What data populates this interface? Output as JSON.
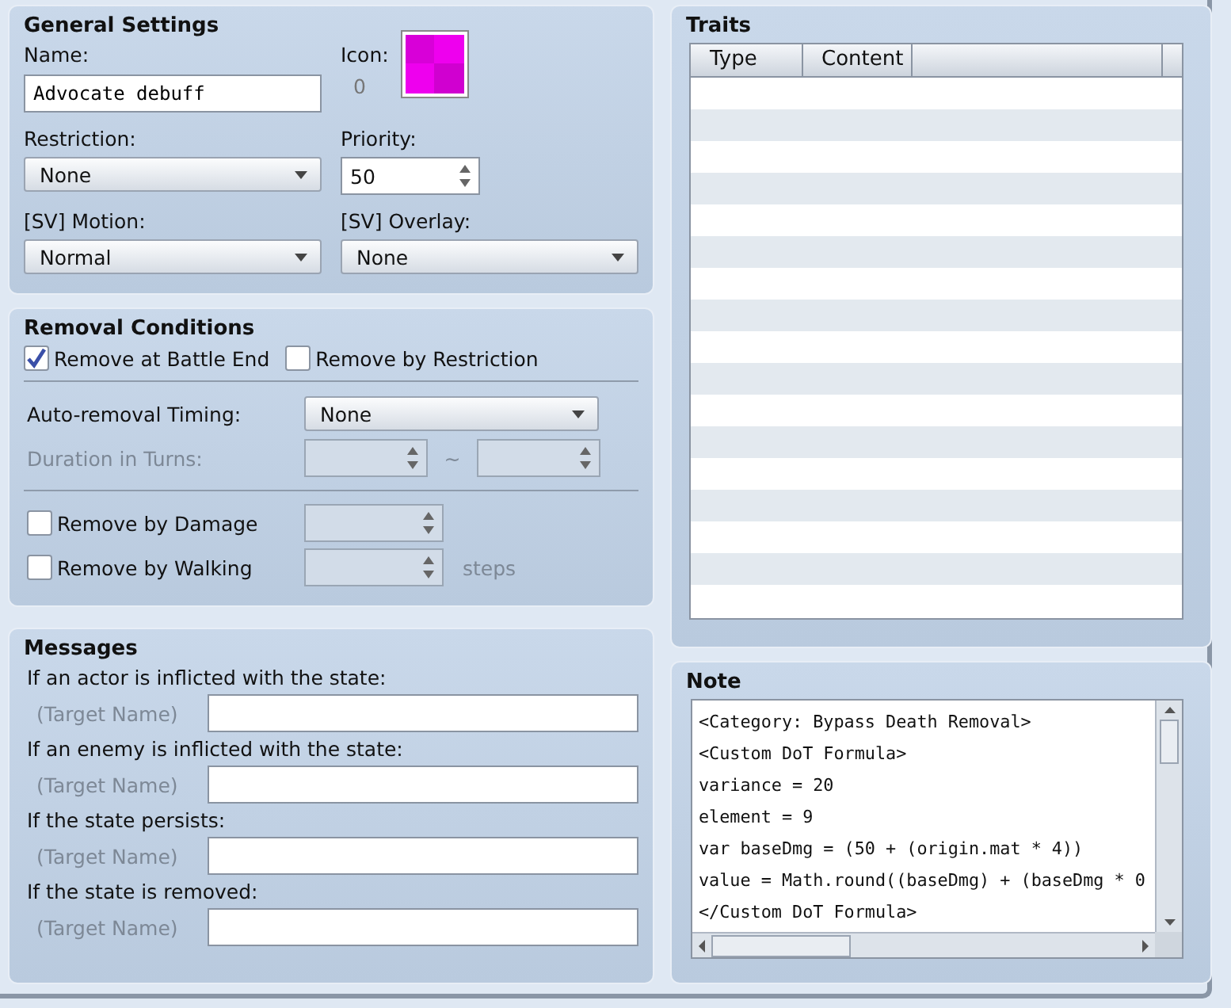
{
  "general_settings": {
    "title": "General Settings",
    "name_label": "Name:",
    "name_value": "Advocate debuff",
    "icon_label": "Icon:",
    "icon_index": "0",
    "restriction_label": "Restriction:",
    "restriction_value": "None",
    "priority_label": "Priority:",
    "priority_value": "50",
    "motion_label": "[SV] Motion:",
    "motion_value": "Normal",
    "overlay_label": "[SV] Overlay:",
    "overlay_value": "None"
  },
  "removal_conditions": {
    "title": "Removal Conditions",
    "checks": [
      {
        "label": "Remove at Battle End",
        "checked": true
      },
      {
        "label": "Remove by Restriction",
        "checked": false
      }
    ],
    "timing_label": "Auto-removal Timing:",
    "timing_value": "None",
    "duration_label": "Duration in Turns:",
    "duration_disabled": true,
    "range_separator": "~",
    "damage": {
      "label": "Remove by Damage",
      "checked": false
    },
    "walking": {
      "label": "Remove by Walking",
      "checked": false,
      "unit": "steps"
    }
  },
  "messages": {
    "title": "Messages",
    "items": [
      {
        "label": "If an actor is inflicted with the state:",
        "prefix": "(Target Name)"
      },
      {
        "label": "If an enemy is inflicted with the state:",
        "prefix": "(Target Name)"
      },
      {
        "label": "If the state persists:",
        "prefix": "(Target Name)"
      },
      {
        "label": "If the state is removed:",
        "prefix": "(Target Name)"
      }
    ]
  },
  "traits": {
    "title": "Traits",
    "columns": [
      "Type",
      "Content"
    ]
  },
  "note": {
    "title": "Note",
    "lines": [
      "<Category: Bypass Death Removal>",
      "<Custom DoT Formula>",
      "variance = 20",
      "element = 9",
      "var baseDmg = (50 + (origin.mat * 4))",
      "value = Math.round((baseDmg) + (baseDmg * 0",
      "</Custom DoT Formula>"
    ]
  }
}
